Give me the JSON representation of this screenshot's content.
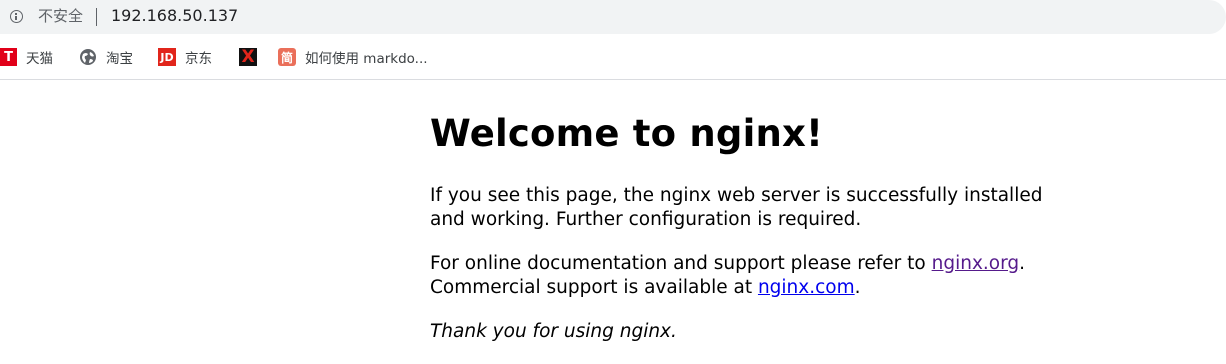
{
  "browser": {
    "security_label": "不安全",
    "url": "192.168.50.137"
  },
  "bookmarks": [
    {
      "label": "天猫",
      "icon": "tmall-icon",
      "icon_glyph": "T"
    },
    {
      "label": "淘宝",
      "icon": "globe-icon"
    },
    {
      "label": "京东",
      "icon": "jd-icon",
      "icon_glyph": "JD"
    },
    {
      "label": "",
      "icon": "x-icon",
      "icon_glyph": "X"
    },
    {
      "label": "如何使用 markdo...",
      "icon": "jianshu-icon",
      "icon_glyph": "简"
    }
  ],
  "page": {
    "heading": "Welcome to nginx!",
    "para1": "If you see this page, the nginx web server is successfully installed and working. Further configuration is required.",
    "para2_prefix": "For online documentation and support please refer to ",
    "link_org": "nginx.org",
    "para2_mid": ".",
    "para2_line2": "Commercial support is available at ",
    "link_com": "nginx.com",
    "para2_end": ".",
    "para3": "Thank you for using nginx."
  },
  "colors": {
    "link_visited": "#551a8b",
    "link_unvisited": "#0000ee",
    "omnibox_bg": "#f1f3f4"
  }
}
